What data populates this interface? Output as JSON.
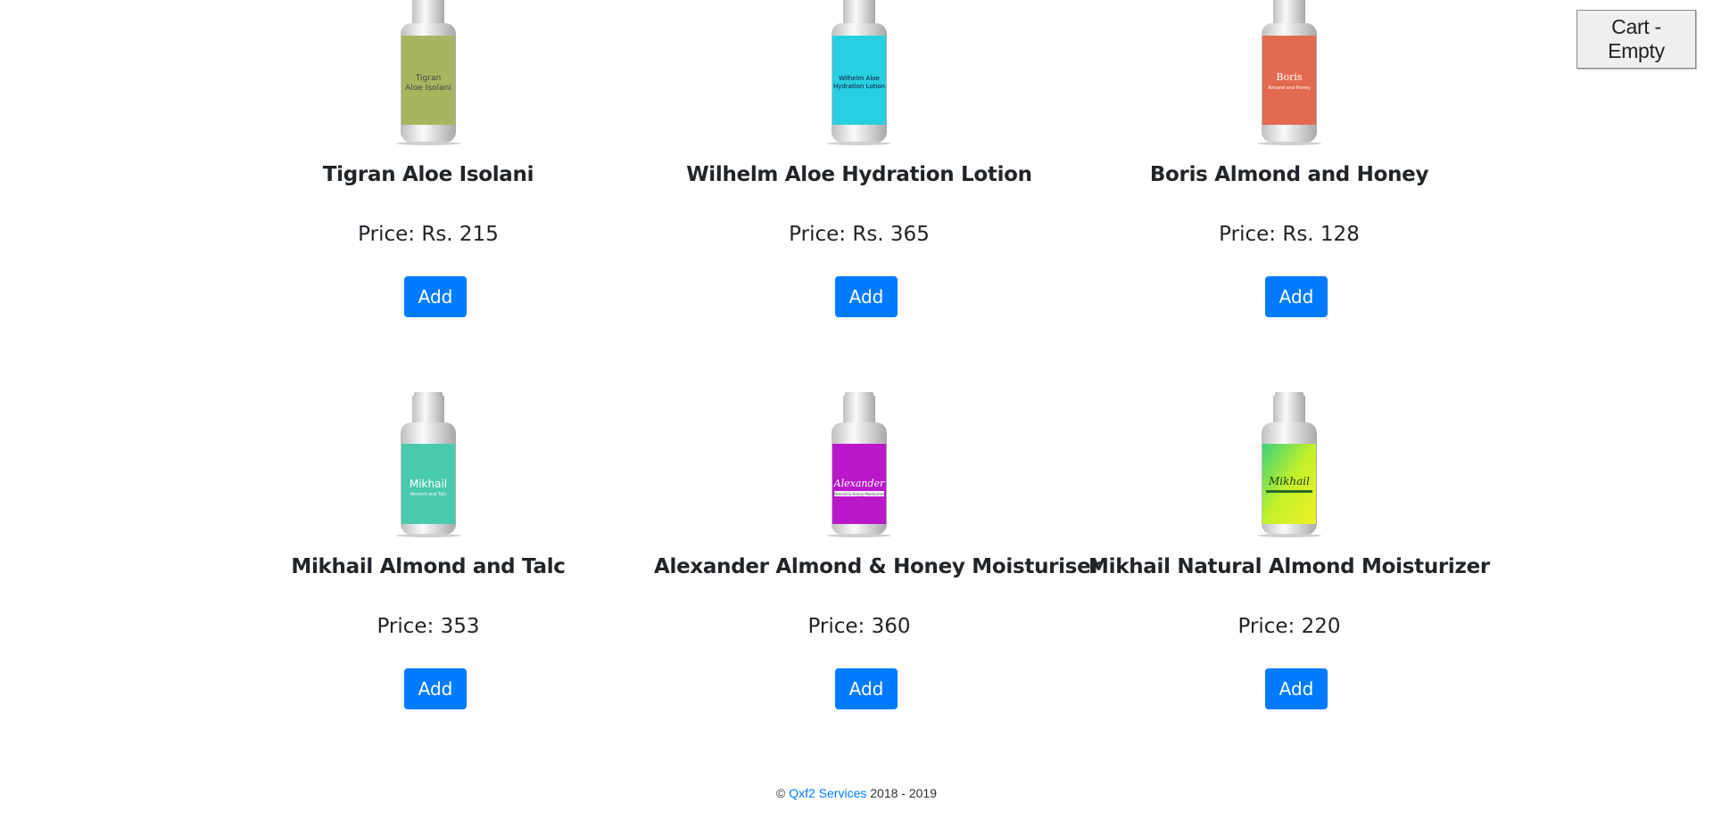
{
  "cart": {
    "label": "Cart - Empty"
  },
  "products": [
    {
      "name": "Tigran Aloe Isolani",
      "price": "Price: Rs. 215",
      "add_label": "Add",
      "label_text": "Tigran Aloe Isolani",
      "label_color": "#a9b45f"
    },
    {
      "name": "Wilhelm Aloe Hydration Lotion",
      "price": "Price: Rs. 365",
      "add_label": "Add",
      "label_text": "Wilhelm Aloe Hydration Lotion",
      "label_color": "#27cfe0"
    },
    {
      "name": "Boris Almond and Honey",
      "price": "Price: Rs. 128",
      "add_label": "Add",
      "label_text": "Boris Almond and Honey",
      "label_color": "#e26a50"
    },
    {
      "name": "Mikhail Almond and Talc",
      "price": "Price: 353",
      "add_label": "Add",
      "label_text": "Mikhail Almond and Talc",
      "label_color": "#49c9ad"
    },
    {
      "name": "Alexander Almond & Honey Moisturiser",
      "price": "Price: 360",
      "add_label": "Add",
      "label_text": "Alexander Almond & Honey Moisturiser",
      "label_color": "#b818c8"
    },
    {
      "name": "Mikhail Natural Almond Moisturizer",
      "price": "Price: 220",
      "add_label": "Add",
      "label_text": "Mikhail",
      "label_color": "#8fe030"
    }
  ],
  "footer": {
    "copyright": "©",
    "company": "Qxf2 Services",
    "years": "2018 - 2019"
  }
}
